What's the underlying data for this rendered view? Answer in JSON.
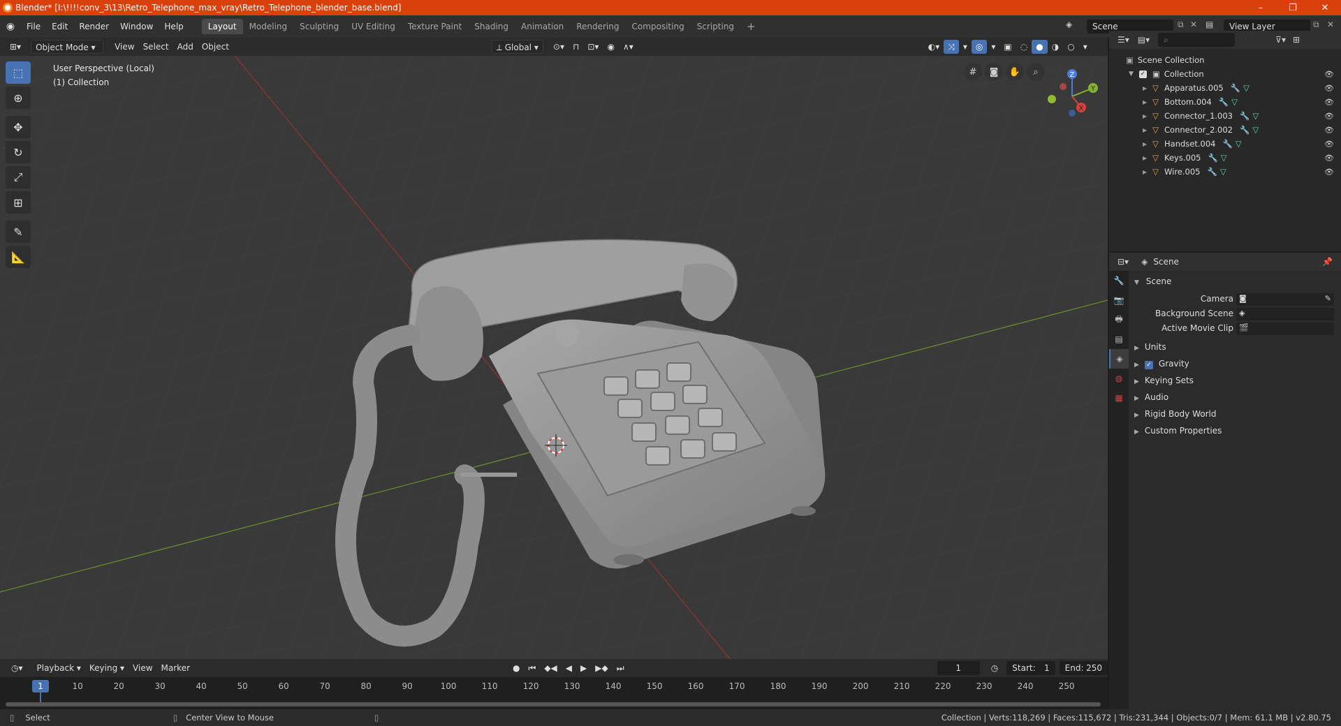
{
  "titlebar": {
    "title": "Blender* [I:\\!!!!conv_3\\13\\Retro_Telephone_max_vray\\Retro_Telephone_blender_base.blend]",
    "minimize": "–",
    "maximize": "❐",
    "close": "✕"
  },
  "menu": {
    "items": [
      "File",
      "Edit",
      "Render",
      "Window",
      "Help"
    ]
  },
  "workspaces": {
    "tabs": [
      "Layout",
      "Modeling",
      "Sculpting",
      "UV Editing",
      "Texture Paint",
      "Shading",
      "Animation",
      "Rendering",
      "Compositing",
      "Scripting"
    ],
    "add": "+"
  },
  "scene_selector": {
    "value": "Scene"
  },
  "view_layer": {
    "value": "View Layer"
  },
  "viewport_header": {
    "mode": "Object Mode",
    "menus": [
      "View",
      "Select",
      "Add",
      "Object"
    ],
    "transform": "Global"
  },
  "viewport": {
    "perspective": "User Perspective (Local)",
    "collection": "(1) Collection"
  },
  "gizmo": {
    "z": "Z",
    "y": "Y",
    "x": "X"
  },
  "outliner": {
    "root": "Scene Collection",
    "collection": "Collection",
    "objects": [
      "Apparatus.005",
      "Bottom.004",
      "Connector_1.003",
      "Connector_2.002",
      "Handset.004",
      "Keys.005",
      "Wire.005"
    ]
  },
  "properties": {
    "header": "Scene",
    "section": "Scene",
    "fields": [
      "Camera",
      "Background Scene",
      "Active Movie Clip"
    ],
    "panels": [
      "Units",
      "Gravity",
      "Keying Sets",
      "Audio",
      "Rigid Body World",
      "Custom Properties"
    ]
  },
  "timeline_header": {
    "menus": [
      "Playback",
      "Keying",
      "View",
      "Marker"
    ],
    "current_frame": "1",
    "start_label": "Start:",
    "start": "1",
    "end_label": "End:",
    "end": "250"
  },
  "timeline": {
    "current": "1",
    "ticks": [
      "10",
      "20",
      "30",
      "40",
      "50",
      "60",
      "70",
      "80",
      "90",
      "100",
      "110",
      "120",
      "130",
      "140",
      "150",
      "160",
      "170",
      "180",
      "190",
      "200",
      "210",
      "220",
      "230",
      "240",
      "250"
    ]
  },
  "status": {
    "left": "Select",
    "middle": "Center View to Mouse",
    "right": "Collection | Verts:118,269 | Faces:115,672 | Tris:231,344 | Objects:0/7 | Mem: 61.1 MB | v2.80.75"
  },
  "colors": {
    "accent": "#4772b3",
    "titlebar": "#d9400b",
    "object_icon": "#e79d48",
    "modifier_icon": "#6ea8ff",
    "mesh_icon": "#5ad3b2"
  }
}
